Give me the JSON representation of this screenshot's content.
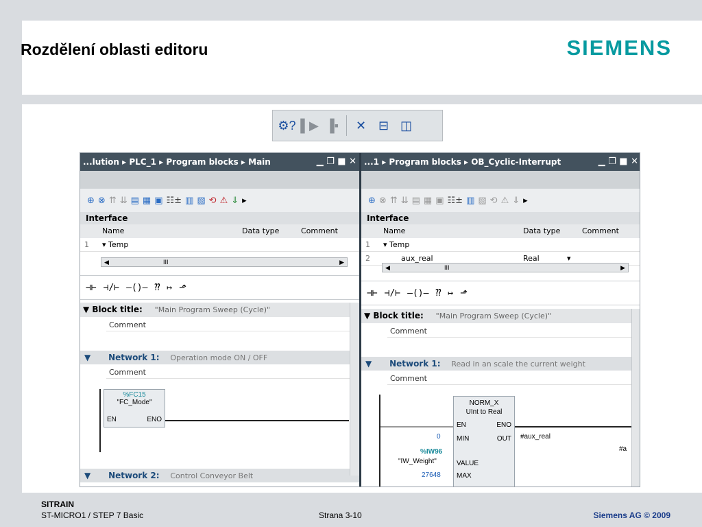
{
  "slide": {
    "title": "Rozdělení oblasti editoru",
    "logo": "SIEMENS"
  },
  "footer": {
    "course": "SITRAIN",
    "module": "ST-MICRO1 / STEP 7 Basic",
    "page": "Strana 3-10",
    "copyright": "Siemens AG © 2009"
  },
  "toolbar": {
    "icons": [
      "library-help-icon",
      "panel-left-icon",
      "panel-right-icon",
      "split-swap-icon",
      "split-horizontal-icon",
      "split-vertical-icon"
    ]
  },
  "left": {
    "breadcrumb": "...lution  ▸  PLC_1  ▸  Program blocks  ▸  Main",
    "window_controls": "▁ ❐ ■ ✕",
    "interface_title": "Interface",
    "columns": [
      "Name",
      "Data type",
      "Comment"
    ],
    "rows": [
      {
        "num": "1",
        "name": "▾ Temp",
        "type": ""
      }
    ],
    "scroll_thumb": "III",
    "block_title": "▼ Block title:",
    "block_title_value": "\"Main Program Sweep (Cycle)\"",
    "comment1": "Comment",
    "network1_label": "Network 1:",
    "network1_desc": "Operation mode ON / OFF",
    "comment2": "Comment",
    "fc_addr": "%FC15",
    "fc_name": "\"FC_Mode\"",
    "fc_en": "EN",
    "fc_eno": "ENO",
    "network2_label": "Network 2:",
    "network2_desc": "Control Conveyor Belt"
  },
  "right": {
    "breadcrumb": "...1  ▸  Program blocks  ▸  OB_Cyclic-Interrupt",
    "window_controls": "▁ ❐ ■ ✕",
    "interface_title": "Interface",
    "columns": [
      "Name",
      "Data type",
      "Comment"
    ],
    "rows": [
      {
        "num": "1",
        "name": "▾ Temp",
        "type": ""
      },
      {
        "num": "2",
        "name": "aux_real",
        "type": "Real"
      }
    ],
    "scroll_thumb": "III",
    "block_title": "▼ Block title:",
    "block_title_value": "\"Main Program Sweep (Cycle)\"",
    "comment1": "Comment",
    "network1_label": "Network 1:",
    "network1_desc": "Read in an scale the current weight",
    "comment2": "Comment",
    "fb_name": "NORM_X",
    "fb_type": "UInt to Real",
    "fb_en": "EN",
    "fb_eno": "ENO",
    "fb_min": "MIN",
    "fb_out": "OUT",
    "fb_value": "VALUE",
    "fb_max": "MAX",
    "in_min": "0",
    "out_val": "#aux_real",
    "in_val_addr": "%IW96",
    "in_val_name": "\"IW_Weight\"",
    "in_max": "27648",
    "hash_a": "#a"
  },
  "ladder_icons": [
    "⊣⊢",
    "⊣/⊢",
    "–()–",
    "⁇",
    "↦",
    "⬏"
  ]
}
